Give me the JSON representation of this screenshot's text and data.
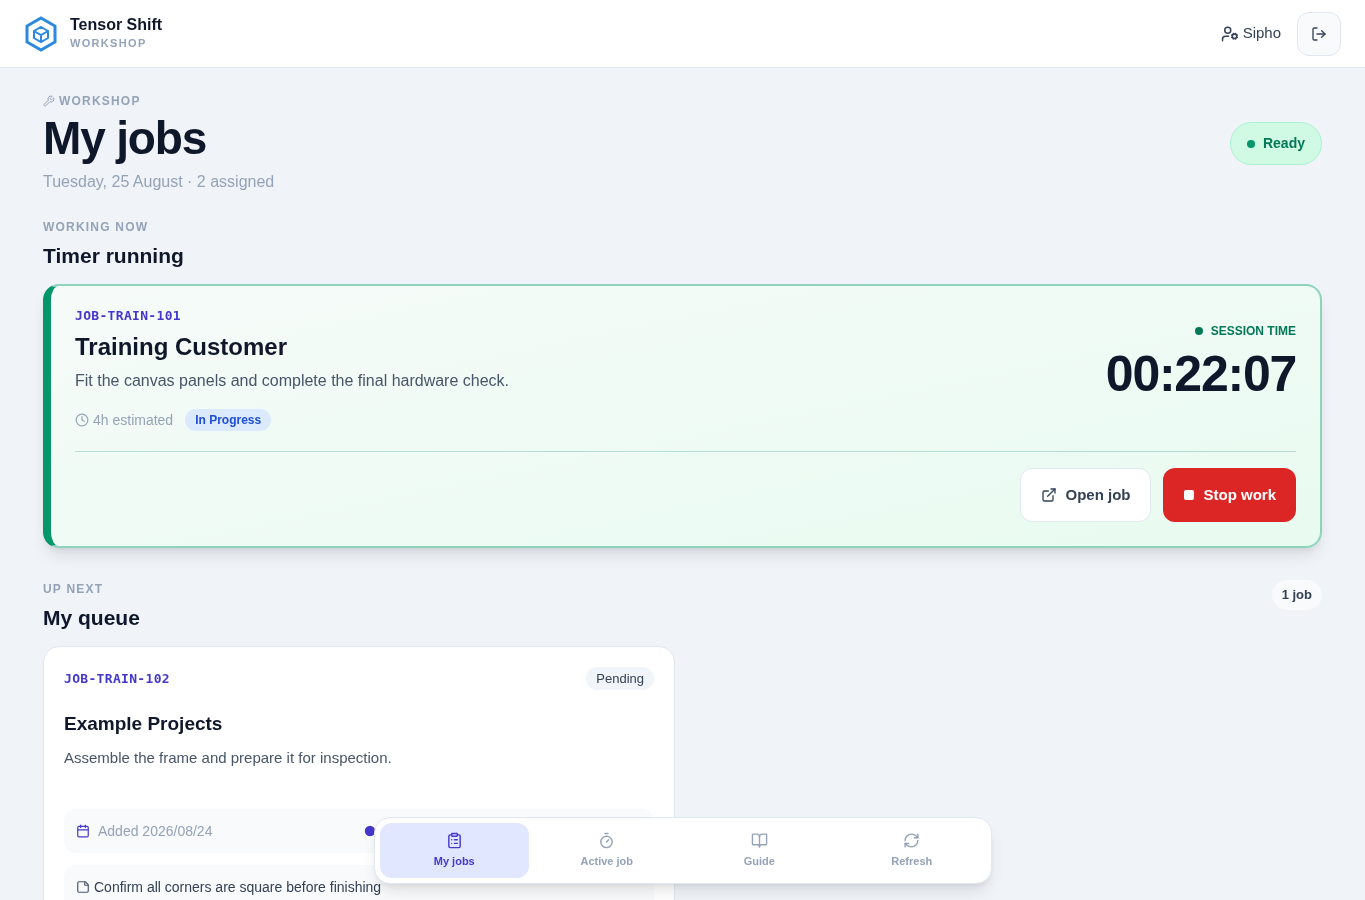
{
  "header": {
    "brand": "Tensor Shift",
    "subtitle": "WORKSHOP",
    "user": "Sipho"
  },
  "page": {
    "eyebrow": "WORKSHOP",
    "title": "My jobs",
    "meta": "Tuesday, 25 August · 2 assigned",
    "status": {
      "label": "Ready",
      "color": "#059669"
    }
  },
  "working": {
    "eyebrow": "WORKING NOW",
    "title": "Timer running"
  },
  "active_job": {
    "code": "JOB-TRAIN-101",
    "title": "Training Customer",
    "description": "Fit the canvas panels and complete the final hardware check.",
    "estimate": "4h estimated",
    "status": "In Progress",
    "session_label": "SESSION TIME",
    "timer": "00:22:07",
    "actions": [
      {
        "kind": "open",
        "label": "Open job"
      },
      {
        "kind": "stop",
        "label": "Stop work"
      }
    ]
  },
  "queue": {
    "eyebrow": "UP NEXT",
    "title": "My queue",
    "count": "1 job",
    "jobs": [
      {
        "code": "JOB-TRAIN-102",
        "status": "Pending",
        "title": "Example Projects",
        "description": "Assemble the frame and prepare it for inspection.",
        "added": "Added 2026/08/24",
        "note": "Confirm all corners are square before finishing"
      }
    ]
  },
  "bottom_nav": [
    {
      "kind": "jobs",
      "label": "My jobs",
      "selected": true
    },
    {
      "kind": "timer",
      "label": "Active job",
      "selected": false
    },
    {
      "kind": "guide",
      "label": "Guide",
      "selected": false
    },
    {
      "kind": "refresh",
      "label": "Refresh",
      "selected": false
    }
  ]
}
